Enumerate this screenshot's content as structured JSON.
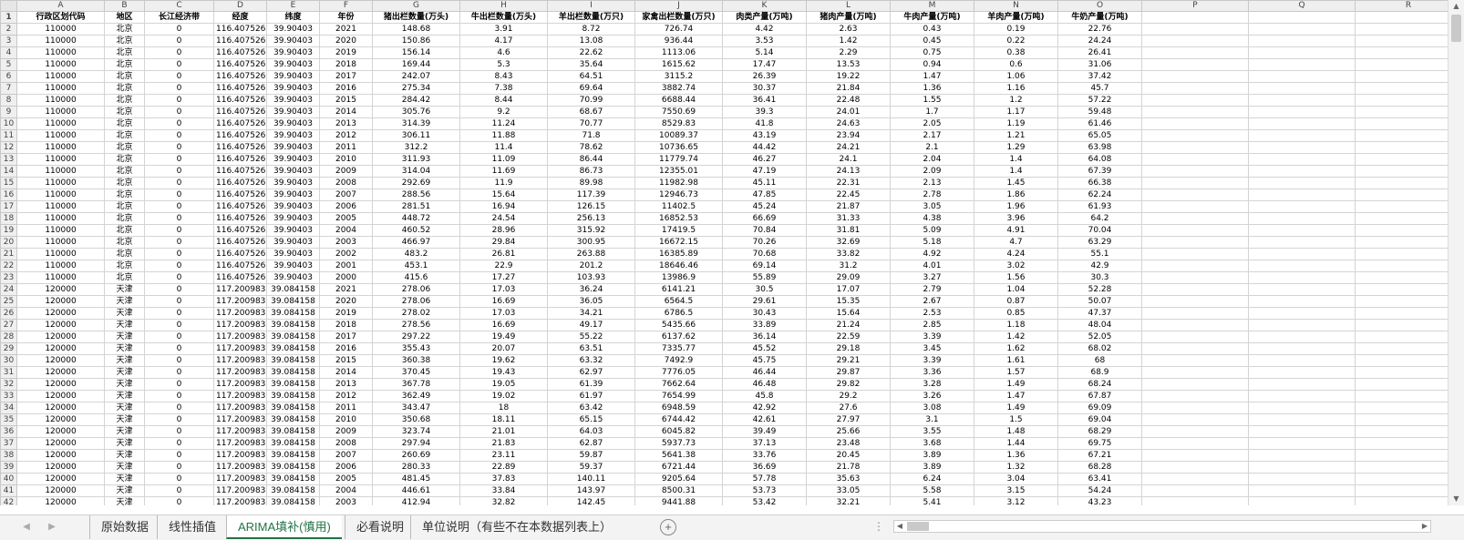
{
  "columns": [
    "A",
    "B",
    "C",
    "D",
    "E",
    "F",
    "G",
    "H",
    "I",
    "J",
    "K",
    "L",
    "M",
    "N",
    "O",
    "P",
    "Q",
    "R"
  ],
  "headers": [
    "行政区划代码",
    "地区",
    "长江经济带",
    "经度",
    "纬度",
    "年份",
    "猪出栏数量(万头)",
    "牛出栏数量(万头)",
    "羊出栏数量(万只)",
    "家禽出栏数量(万只)",
    "肉类产量(万吨)",
    "猪肉产量(万吨)",
    "牛肉产量(万吨)",
    "羊肉产量(万吨)",
    "牛奶产量(万吨)"
  ],
  "rows": [
    [
      "110000",
      "北京",
      "0",
      "116.407526",
      "39.90403",
      "2021",
      "148.68",
      "3.91",
      "8.72",
      "726.74",
      "4.42",
      "2.63",
      "0.43",
      "0.19",
      "22.76"
    ],
    [
      "110000",
      "北京",
      "0",
      "116.407526",
      "39.90403",
      "2020",
      "150.86",
      "4.17",
      "13.08",
      "936.44",
      "3.53",
      "1.42",
      "0.45",
      "0.22",
      "24.24"
    ],
    [
      "110000",
      "北京",
      "0",
      "116.407526",
      "39.90403",
      "2019",
      "156.14",
      "4.6",
      "22.62",
      "1113.06",
      "5.14",
      "2.29",
      "0.75",
      "0.38",
      "26.41"
    ],
    [
      "110000",
      "北京",
      "0",
      "116.407526",
      "39.90403",
      "2018",
      "169.44",
      "5.3",
      "35.64",
      "1615.62",
      "17.47",
      "13.53",
      "0.94",
      "0.6",
      "31.06"
    ],
    [
      "110000",
      "北京",
      "0",
      "116.407526",
      "39.90403",
      "2017",
      "242.07",
      "8.43",
      "64.51",
      "3115.2",
      "26.39",
      "19.22",
      "1.47",
      "1.06",
      "37.42"
    ],
    [
      "110000",
      "北京",
      "0",
      "116.407526",
      "39.90403",
      "2016",
      "275.34",
      "7.38",
      "69.64",
      "3882.74",
      "30.37",
      "21.84",
      "1.36",
      "1.16",
      "45.7"
    ],
    [
      "110000",
      "北京",
      "0",
      "116.407526",
      "39.90403",
      "2015",
      "284.42",
      "8.44",
      "70.99",
      "6688.44",
      "36.41",
      "22.48",
      "1.55",
      "1.2",
      "57.22"
    ],
    [
      "110000",
      "北京",
      "0",
      "116.407526",
      "39.90403",
      "2014",
      "305.76",
      "9.2",
      "68.67",
      "7550.69",
      "39.3",
      "24.01",
      "1.7",
      "1.17",
      "59.48"
    ],
    [
      "110000",
      "北京",
      "0",
      "116.407526",
      "39.90403",
      "2013",
      "314.39",
      "11.24",
      "70.77",
      "8529.83",
      "41.8",
      "24.63",
      "2.05",
      "1.19",
      "61.46"
    ],
    [
      "110000",
      "北京",
      "0",
      "116.407526",
      "39.90403",
      "2012",
      "306.11",
      "11.88",
      "71.8",
      "10089.37",
      "43.19",
      "23.94",
      "2.17",
      "1.21",
      "65.05"
    ],
    [
      "110000",
      "北京",
      "0",
      "116.407526",
      "39.90403",
      "2011",
      "312.2",
      "11.4",
      "78.62",
      "10736.65",
      "44.42",
      "24.21",
      "2.1",
      "1.29",
      "63.98"
    ],
    [
      "110000",
      "北京",
      "0",
      "116.407526",
      "39.90403",
      "2010",
      "311.93",
      "11.09",
      "86.44",
      "11779.74",
      "46.27",
      "24.1",
      "2.04",
      "1.4",
      "64.08"
    ],
    [
      "110000",
      "北京",
      "0",
      "116.407526",
      "39.90403",
      "2009",
      "314.04",
      "11.69",
      "86.73",
      "12355.01",
      "47.19",
      "24.13",
      "2.09",
      "1.4",
      "67.39"
    ],
    [
      "110000",
      "北京",
      "0",
      "116.407526",
      "39.90403",
      "2008",
      "292.69",
      "11.9",
      "89.98",
      "11982.98",
      "45.11",
      "22.31",
      "2.13",
      "1.45",
      "66.38"
    ],
    [
      "110000",
      "北京",
      "0",
      "116.407526",
      "39.90403",
      "2007",
      "288.56",
      "15.64",
      "117.39",
      "12946.73",
      "47.85",
      "22.45",
      "2.78",
      "1.86",
      "62.24"
    ],
    [
      "110000",
      "北京",
      "0",
      "116.407526",
      "39.90403",
      "2006",
      "281.51",
      "16.94",
      "126.15",
      "11402.5",
      "45.24",
      "21.87",
      "3.05",
      "1.96",
      "61.93"
    ],
    [
      "110000",
      "北京",
      "0",
      "116.407526",
      "39.90403",
      "2005",
      "448.72",
      "24.54",
      "256.13",
      "16852.53",
      "66.69",
      "31.33",
      "4.38",
      "3.96",
      "64.2"
    ],
    [
      "110000",
      "北京",
      "0",
      "116.407526",
      "39.90403",
      "2004",
      "460.52",
      "28.96",
      "315.92",
      "17419.5",
      "70.84",
      "31.81",
      "5.09",
      "4.91",
      "70.04"
    ],
    [
      "110000",
      "北京",
      "0",
      "116.407526",
      "39.90403",
      "2003",
      "466.97",
      "29.84",
      "300.95",
      "16672.15",
      "70.26",
      "32.69",
      "5.18",
      "4.7",
      "63.29"
    ],
    [
      "110000",
      "北京",
      "0",
      "116.407526",
      "39.90403",
      "2002",
      "483.2",
      "26.81",
      "263.88",
      "16385.89",
      "70.68",
      "33.82",
      "4.92",
      "4.24",
      "55.1"
    ],
    [
      "110000",
      "北京",
      "0",
      "116.407526",
      "39.90403",
      "2001",
      "453.1",
      "22.9",
      "201.2",
      "18646.46",
      "69.14",
      "31.2",
      "4.01",
      "3.02",
      "42.9"
    ],
    [
      "110000",
      "北京",
      "0",
      "116.407526",
      "39.90403",
      "2000",
      "415.6",
      "17.27",
      "103.93",
      "13986.9",
      "55.89",
      "29.09",
      "3.27",
      "1.56",
      "30.3"
    ],
    [
      "120000",
      "天津",
      "0",
      "117.200983",
      "39.084158",
      "2021",
      "278.06",
      "17.03",
      "36.24",
      "6141.21",
      "30.5",
      "17.07",
      "2.79",
      "1.04",
      "52.28"
    ],
    [
      "120000",
      "天津",
      "0",
      "117.200983",
      "39.084158",
      "2020",
      "278.06",
      "16.69",
      "36.05",
      "6564.5",
      "29.61",
      "15.35",
      "2.67",
      "0.87",
      "50.07"
    ],
    [
      "120000",
      "天津",
      "0",
      "117.200983",
      "39.084158",
      "2019",
      "278.02",
      "17.03",
      "34.21",
      "6786.5",
      "30.43",
      "15.64",
      "2.53",
      "0.85",
      "47.37"
    ],
    [
      "120000",
      "天津",
      "0",
      "117.200983",
      "39.084158",
      "2018",
      "278.56",
      "16.69",
      "49.17",
      "5435.66",
      "33.89",
      "21.24",
      "2.85",
      "1.18",
      "48.04"
    ],
    [
      "120000",
      "天津",
      "0",
      "117.200983",
      "39.084158",
      "2017",
      "297.22",
      "19.49",
      "55.22",
      "6137.62",
      "36.14",
      "22.59",
      "3.39",
      "1.42",
      "52.05"
    ],
    [
      "120000",
      "天津",
      "0",
      "117.200983",
      "39.084158",
      "2016",
      "355.43",
      "20.07",
      "63.51",
      "7335.77",
      "45.52",
      "29.18",
      "3.45",
      "1.62",
      "68.02"
    ],
    [
      "120000",
      "天津",
      "0",
      "117.200983",
      "39.084158",
      "2015",
      "360.38",
      "19.62",
      "63.32",
      "7492.9",
      "45.75",
      "29.21",
      "3.39",
      "1.61",
      "68"
    ],
    [
      "120000",
      "天津",
      "0",
      "117.200983",
      "39.084158",
      "2014",
      "370.45",
      "19.43",
      "62.97",
      "7776.05",
      "46.44",
      "29.87",
      "3.36",
      "1.57",
      "68.9"
    ],
    [
      "120000",
      "天津",
      "0",
      "117.200983",
      "39.084158",
      "2013",
      "367.78",
      "19.05",
      "61.39",
      "7662.64",
      "46.48",
      "29.82",
      "3.28",
      "1.49",
      "68.24"
    ],
    [
      "120000",
      "天津",
      "0",
      "117.200983",
      "39.084158",
      "2012",
      "362.49",
      "19.02",
      "61.97",
      "7654.99",
      "45.8",
      "29.2",
      "3.26",
      "1.47",
      "67.87"
    ],
    [
      "120000",
      "天津",
      "0",
      "117.200983",
      "39.084158",
      "2011",
      "343.47",
      "18",
      "63.42",
      "6948.59",
      "42.92",
      "27.6",
      "3.08",
      "1.49",
      "69.09"
    ],
    [
      "120000",
      "天津",
      "0",
      "117.200983",
      "39.084158",
      "2010",
      "350.68",
      "18.11",
      "65.15",
      "6744.42",
      "42.61",
      "27.97",
      "3.1",
      "1.5",
      "69.04"
    ],
    [
      "120000",
      "天津",
      "0",
      "117.200983",
      "39.084158",
      "2009",
      "323.74",
      "21.01",
      "64.03",
      "6045.82",
      "39.49",
      "25.66",
      "3.55",
      "1.48",
      "68.29"
    ],
    [
      "120000",
      "天津",
      "0",
      "117.200983",
      "39.084158",
      "2008",
      "297.94",
      "21.83",
      "62.87",
      "5937.73",
      "37.13",
      "23.48",
      "3.68",
      "1.44",
      "69.75"
    ],
    [
      "120000",
      "天津",
      "0",
      "117.200983",
      "39.084158",
      "2007",
      "260.69",
      "23.11",
      "59.87",
      "5641.38",
      "33.76",
      "20.45",
      "3.89",
      "1.36",
      "67.21"
    ],
    [
      "120000",
      "天津",
      "0",
      "117.200983",
      "39.084158",
      "2006",
      "280.33",
      "22.89",
      "59.37",
      "6721.44",
      "36.69",
      "21.78",
      "3.89",
      "1.32",
      "68.28"
    ],
    [
      "120000",
      "天津",
      "0",
      "117.200983",
      "39.084158",
      "2005",
      "481.45",
      "37.83",
      "140.11",
      "9205.64",
      "57.78",
      "35.63",
      "6.24",
      "3.04",
      "63.41"
    ],
    [
      "120000",
      "天津",
      "0",
      "117.200983",
      "39.084158",
      "2004",
      "446.61",
      "33.84",
      "143.97",
      "8500.31",
      "53.73",
      "33.05",
      "5.58",
      "3.15",
      "54.24"
    ],
    [
      "120000",
      "天津",
      "0",
      "117.200983",
      "39.084158",
      "2003",
      "412.94",
      "32.82",
      "142.45",
      "9441.88",
      "53.42",
      "32.21",
      "5.41",
      "3.12",
      "43.23"
    ]
  ],
  "sheet_tabs": [
    "原始数据",
    "线性插值",
    "ARIMA填补(慎用)",
    "必看说明",
    "单位说明（有些不在本数据列表上）"
  ],
  "active_tab_index": 2,
  "icons": {
    "add_sheet": "plus-circle-icon",
    "scroll_left": "triangle-left-icon",
    "scroll_right": "triangle-right-icon",
    "scroll_up": "triangle-up-icon",
    "scroll_down": "triangle-down-icon",
    "more": "ellipsis-icon"
  },
  "colors": {
    "active_tab": "#217346",
    "header_bg": "#efefef",
    "grid": "#d4d4d4"
  }
}
